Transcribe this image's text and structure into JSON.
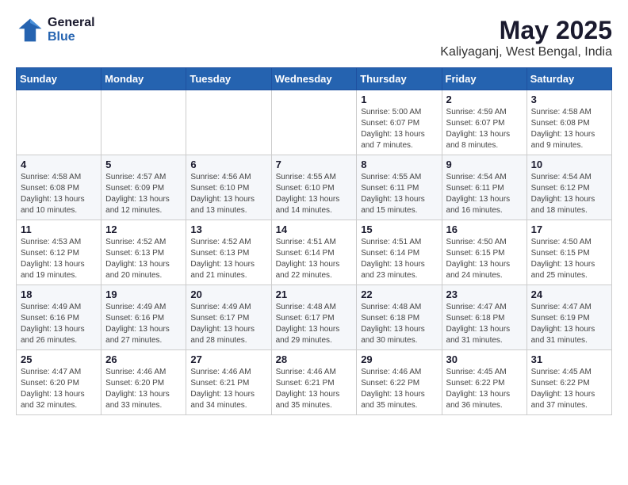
{
  "logo": {
    "line1": "General",
    "line2": "Blue"
  },
  "title": "May 2025",
  "subtitle": "Kaliyaganj, West Bengal, India",
  "weekdays": [
    "Sunday",
    "Monday",
    "Tuesday",
    "Wednesday",
    "Thursday",
    "Friday",
    "Saturday"
  ],
  "weeks": [
    [
      {
        "day": "",
        "info": ""
      },
      {
        "day": "",
        "info": ""
      },
      {
        "day": "",
        "info": ""
      },
      {
        "day": "",
        "info": ""
      },
      {
        "day": "1",
        "info": "Sunrise: 5:00 AM\nSunset: 6:07 PM\nDaylight: 13 hours\nand 7 minutes."
      },
      {
        "day": "2",
        "info": "Sunrise: 4:59 AM\nSunset: 6:07 PM\nDaylight: 13 hours\nand 8 minutes."
      },
      {
        "day": "3",
        "info": "Sunrise: 4:58 AM\nSunset: 6:08 PM\nDaylight: 13 hours\nand 9 minutes."
      }
    ],
    [
      {
        "day": "4",
        "info": "Sunrise: 4:58 AM\nSunset: 6:08 PM\nDaylight: 13 hours\nand 10 minutes."
      },
      {
        "day": "5",
        "info": "Sunrise: 4:57 AM\nSunset: 6:09 PM\nDaylight: 13 hours\nand 12 minutes."
      },
      {
        "day": "6",
        "info": "Sunrise: 4:56 AM\nSunset: 6:10 PM\nDaylight: 13 hours\nand 13 minutes."
      },
      {
        "day": "7",
        "info": "Sunrise: 4:55 AM\nSunset: 6:10 PM\nDaylight: 13 hours\nand 14 minutes."
      },
      {
        "day": "8",
        "info": "Sunrise: 4:55 AM\nSunset: 6:11 PM\nDaylight: 13 hours\nand 15 minutes."
      },
      {
        "day": "9",
        "info": "Sunrise: 4:54 AM\nSunset: 6:11 PM\nDaylight: 13 hours\nand 16 minutes."
      },
      {
        "day": "10",
        "info": "Sunrise: 4:54 AM\nSunset: 6:12 PM\nDaylight: 13 hours\nand 18 minutes."
      }
    ],
    [
      {
        "day": "11",
        "info": "Sunrise: 4:53 AM\nSunset: 6:12 PM\nDaylight: 13 hours\nand 19 minutes."
      },
      {
        "day": "12",
        "info": "Sunrise: 4:52 AM\nSunset: 6:13 PM\nDaylight: 13 hours\nand 20 minutes."
      },
      {
        "day": "13",
        "info": "Sunrise: 4:52 AM\nSunset: 6:13 PM\nDaylight: 13 hours\nand 21 minutes."
      },
      {
        "day": "14",
        "info": "Sunrise: 4:51 AM\nSunset: 6:14 PM\nDaylight: 13 hours\nand 22 minutes."
      },
      {
        "day": "15",
        "info": "Sunrise: 4:51 AM\nSunset: 6:14 PM\nDaylight: 13 hours\nand 23 minutes."
      },
      {
        "day": "16",
        "info": "Sunrise: 4:50 AM\nSunset: 6:15 PM\nDaylight: 13 hours\nand 24 minutes."
      },
      {
        "day": "17",
        "info": "Sunrise: 4:50 AM\nSunset: 6:15 PM\nDaylight: 13 hours\nand 25 minutes."
      }
    ],
    [
      {
        "day": "18",
        "info": "Sunrise: 4:49 AM\nSunset: 6:16 PM\nDaylight: 13 hours\nand 26 minutes."
      },
      {
        "day": "19",
        "info": "Sunrise: 4:49 AM\nSunset: 6:16 PM\nDaylight: 13 hours\nand 27 minutes."
      },
      {
        "day": "20",
        "info": "Sunrise: 4:49 AM\nSunset: 6:17 PM\nDaylight: 13 hours\nand 28 minutes."
      },
      {
        "day": "21",
        "info": "Sunrise: 4:48 AM\nSunset: 6:17 PM\nDaylight: 13 hours\nand 29 minutes."
      },
      {
        "day": "22",
        "info": "Sunrise: 4:48 AM\nSunset: 6:18 PM\nDaylight: 13 hours\nand 30 minutes."
      },
      {
        "day": "23",
        "info": "Sunrise: 4:47 AM\nSunset: 6:18 PM\nDaylight: 13 hours\nand 31 minutes."
      },
      {
        "day": "24",
        "info": "Sunrise: 4:47 AM\nSunset: 6:19 PM\nDaylight: 13 hours\nand 31 minutes."
      }
    ],
    [
      {
        "day": "25",
        "info": "Sunrise: 4:47 AM\nSunset: 6:20 PM\nDaylight: 13 hours\nand 32 minutes."
      },
      {
        "day": "26",
        "info": "Sunrise: 4:46 AM\nSunset: 6:20 PM\nDaylight: 13 hours\nand 33 minutes."
      },
      {
        "day": "27",
        "info": "Sunrise: 4:46 AM\nSunset: 6:21 PM\nDaylight: 13 hours\nand 34 minutes."
      },
      {
        "day": "28",
        "info": "Sunrise: 4:46 AM\nSunset: 6:21 PM\nDaylight: 13 hours\nand 35 minutes."
      },
      {
        "day": "29",
        "info": "Sunrise: 4:46 AM\nSunset: 6:22 PM\nDaylight: 13 hours\nand 35 minutes."
      },
      {
        "day": "30",
        "info": "Sunrise: 4:45 AM\nSunset: 6:22 PM\nDaylight: 13 hours\nand 36 minutes."
      },
      {
        "day": "31",
        "info": "Sunrise: 4:45 AM\nSunset: 6:22 PM\nDaylight: 13 hours\nand 37 minutes."
      }
    ]
  ]
}
